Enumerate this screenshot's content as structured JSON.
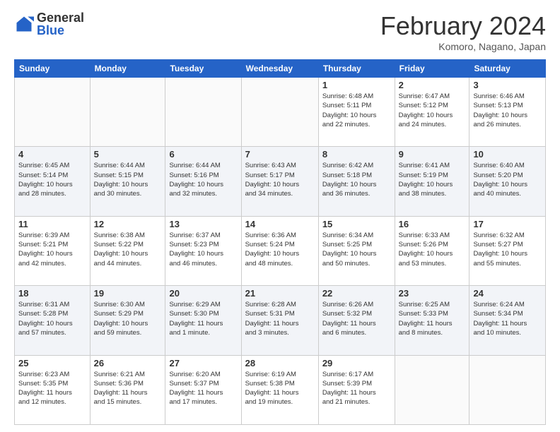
{
  "header": {
    "logo_general": "General",
    "logo_blue": "Blue",
    "month_title": "February 2024",
    "location": "Komoro, Nagano, Japan"
  },
  "days_of_week": [
    "Sunday",
    "Monday",
    "Tuesday",
    "Wednesday",
    "Thursday",
    "Friday",
    "Saturday"
  ],
  "weeks": [
    [
      {
        "day": "",
        "info": ""
      },
      {
        "day": "",
        "info": ""
      },
      {
        "day": "",
        "info": ""
      },
      {
        "day": "",
        "info": ""
      },
      {
        "day": "1",
        "info": "Sunrise: 6:48 AM\nSunset: 5:11 PM\nDaylight: 10 hours\nand 22 minutes."
      },
      {
        "day": "2",
        "info": "Sunrise: 6:47 AM\nSunset: 5:12 PM\nDaylight: 10 hours\nand 24 minutes."
      },
      {
        "day": "3",
        "info": "Sunrise: 6:46 AM\nSunset: 5:13 PM\nDaylight: 10 hours\nand 26 minutes."
      }
    ],
    [
      {
        "day": "4",
        "info": "Sunrise: 6:45 AM\nSunset: 5:14 PM\nDaylight: 10 hours\nand 28 minutes."
      },
      {
        "day": "5",
        "info": "Sunrise: 6:44 AM\nSunset: 5:15 PM\nDaylight: 10 hours\nand 30 minutes."
      },
      {
        "day": "6",
        "info": "Sunrise: 6:44 AM\nSunset: 5:16 PM\nDaylight: 10 hours\nand 32 minutes."
      },
      {
        "day": "7",
        "info": "Sunrise: 6:43 AM\nSunset: 5:17 PM\nDaylight: 10 hours\nand 34 minutes."
      },
      {
        "day": "8",
        "info": "Sunrise: 6:42 AM\nSunset: 5:18 PM\nDaylight: 10 hours\nand 36 minutes."
      },
      {
        "day": "9",
        "info": "Sunrise: 6:41 AM\nSunset: 5:19 PM\nDaylight: 10 hours\nand 38 minutes."
      },
      {
        "day": "10",
        "info": "Sunrise: 6:40 AM\nSunset: 5:20 PM\nDaylight: 10 hours\nand 40 minutes."
      }
    ],
    [
      {
        "day": "11",
        "info": "Sunrise: 6:39 AM\nSunset: 5:21 PM\nDaylight: 10 hours\nand 42 minutes."
      },
      {
        "day": "12",
        "info": "Sunrise: 6:38 AM\nSunset: 5:22 PM\nDaylight: 10 hours\nand 44 minutes."
      },
      {
        "day": "13",
        "info": "Sunrise: 6:37 AM\nSunset: 5:23 PM\nDaylight: 10 hours\nand 46 minutes."
      },
      {
        "day": "14",
        "info": "Sunrise: 6:36 AM\nSunset: 5:24 PM\nDaylight: 10 hours\nand 48 minutes."
      },
      {
        "day": "15",
        "info": "Sunrise: 6:34 AM\nSunset: 5:25 PM\nDaylight: 10 hours\nand 50 minutes."
      },
      {
        "day": "16",
        "info": "Sunrise: 6:33 AM\nSunset: 5:26 PM\nDaylight: 10 hours\nand 53 minutes."
      },
      {
        "day": "17",
        "info": "Sunrise: 6:32 AM\nSunset: 5:27 PM\nDaylight: 10 hours\nand 55 minutes."
      }
    ],
    [
      {
        "day": "18",
        "info": "Sunrise: 6:31 AM\nSunset: 5:28 PM\nDaylight: 10 hours\nand 57 minutes."
      },
      {
        "day": "19",
        "info": "Sunrise: 6:30 AM\nSunset: 5:29 PM\nDaylight: 10 hours\nand 59 minutes."
      },
      {
        "day": "20",
        "info": "Sunrise: 6:29 AM\nSunset: 5:30 PM\nDaylight: 11 hours\nand 1 minute."
      },
      {
        "day": "21",
        "info": "Sunrise: 6:28 AM\nSunset: 5:31 PM\nDaylight: 11 hours\nand 3 minutes."
      },
      {
        "day": "22",
        "info": "Sunrise: 6:26 AM\nSunset: 5:32 PM\nDaylight: 11 hours\nand 6 minutes."
      },
      {
        "day": "23",
        "info": "Sunrise: 6:25 AM\nSunset: 5:33 PM\nDaylight: 11 hours\nand 8 minutes."
      },
      {
        "day": "24",
        "info": "Sunrise: 6:24 AM\nSunset: 5:34 PM\nDaylight: 11 hours\nand 10 minutes."
      }
    ],
    [
      {
        "day": "25",
        "info": "Sunrise: 6:23 AM\nSunset: 5:35 PM\nDaylight: 11 hours\nand 12 minutes."
      },
      {
        "day": "26",
        "info": "Sunrise: 6:21 AM\nSunset: 5:36 PM\nDaylight: 11 hours\nand 15 minutes."
      },
      {
        "day": "27",
        "info": "Sunrise: 6:20 AM\nSunset: 5:37 PM\nDaylight: 11 hours\nand 17 minutes."
      },
      {
        "day": "28",
        "info": "Sunrise: 6:19 AM\nSunset: 5:38 PM\nDaylight: 11 hours\nand 19 minutes."
      },
      {
        "day": "29",
        "info": "Sunrise: 6:17 AM\nSunset: 5:39 PM\nDaylight: 11 hours\nand 21 minutes."
      },
      {
        "day": "",
        "info": ""
      },
      {
        "day": "",
        "info": ""
      }
    ]
  ]
}
